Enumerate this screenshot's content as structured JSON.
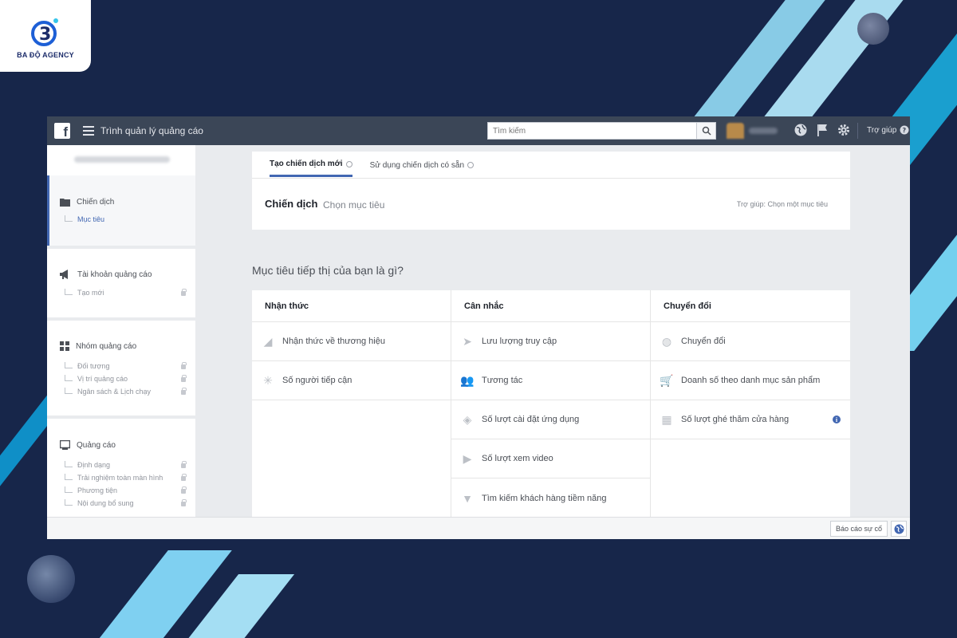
{
  "brand": {
    "agency_name": "BA ĐỘ AGENCY",
    "logo_digit": "3"
  },
  "topbar": {
    "app_title": "Trình quản lý quảng cáo",
    "search_placeholder": "Tìm kiếm",
    "help_label": "Trợ giúp"
  },
  "leftnav": {
    "campaign": {
      "label": "Chiến dịch",
      "sub": "Mục tiêu"
    },
    "ad_account": {
      "label": "Tài khoản quảng cáo",
      "sub": "Tạo mới"
    },
    "ad_set": {
      "label": "Nhóm quảng cáo",
      "subs": [
        "Đối tượng",
        "Vị trí quảng cáo",
        "Ngân sách & Lịch chạy"
      ]
    },
    "ad": {
      "label": "Quảng cáo",
      "subs": [
        "Định dạng",
        "Trải nghiệm toàn màn hình",
        "Phương tiện",
        "Nội dung bổ sung"
      ]
    }
  },
  "tabs": {
    "new_campaign": "Tạo chiến dịch mới",
    "existing_campaign": "Sử dụng chiến dịch có sẵn"
  },
  "campaign_header": {
    "label": "Chiến dịch",
    "sub": "Chọn mục tiêu",
    "help": "Trợ giúp: Chọn một mục tiêu"
  },
  "question": "Mục tiêu tiếp thị của bạn là gì?",
  "objectives": {
    "awareness": {
      "title": "Nhận thức",
      "items": [
        "Nhận thức về thương hiệu",
        "Số người tiếp cận"
      ]
    },
    "consideration": {
      "title": "Cân nhắc",
      "items": [
        "Lưu lượng truy cập",
        "Tương tác",
        "Số lượt cài đặt ứng dụng",
        "Số lượt xem video",
        "Tìm kiếm khách hàng tiềm năng"
      ]
    },
    "conversion": {
      "title": "Chuyển đổi",
      "items": [
        "Chuyển đổi",
        "Doanh số theo danh mục sản phẩm",
        "Số lượt ghé thăm cửa hàng"
      ],
      "info_glyph": "i"
    }
  },
  "bottombar": {
    "report_label": "Báo cáo sự cố"
  },
  "colors": {
    "topbar": "#3b4657",
    "accent": "#4267b2",
    "page_bg": "#17264a"
  }
}
